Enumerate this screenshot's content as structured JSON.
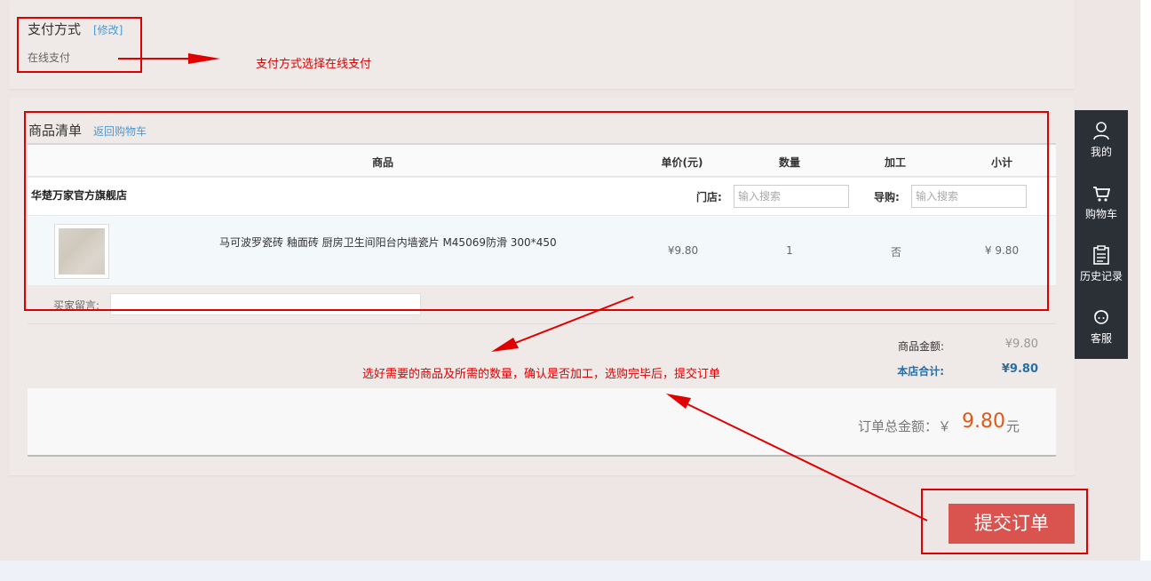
{
  "payment": {
    "title": "支付方式",
    "edit_label": "[修改]",
    "method": "在线支付"
  },
  "product_list": {
    "title": "商品清单",
    "back_to_cart": "返回购物车",
    "columns": [
      "商品",
      "单价(元)",
      "数量",
      "加工",
      "小计"
    ],
    "shop": {
      "name": "华楚万家官方旗舰店",
      "store_label": "门店:",
      "store_placeholder": "输入搜索",
      "guide_label": "导购:",
      "guide_placeholder": "输入搜索"
    },
    "items": [
      {
        "name": "马可波罗瓷砖 釉面砖 厨房卫生间阳台内墙瓷片 M45069防滑 300*450",
        "price": "¥9.80",
        "quantity": "1",
        "processing": "否",
        "subtotal": "¥ 9.80"
      }
    ],
    "memo_label": "买家留言:"
  },
  "summary": {
    "goods_amount_label": "商品金额:",
    "goods_amount": "¥9.80",
    "store_total_label": "本店合计:",
    "store_total": "¥9.80",
    "order_total_label": "订单总金额：￥",
    "order_total": "9.80",
    "order_total_unit": "元"
  },
  "submit": {
    "label": "提交订单"
  },
  "sidebar": {
    "items": [
      {
        "label": "我的",
        "icon": "user-icon"
      },
      {
        "label": "购物车",
        "icon": "cart-icon"
      },
      {
        "label": "历史记录",
        "icon": "clipboard-icon"
      },
      {
        "label": "客服",
        "icon": "headset-icon"
      }
    ]
  },
  "annotations": {
    "payment_note": "支付方式选择在线支付",
    "products_note": "选好需要的商品及所需的数量，确认是否加工，选购完毕后，提交订单",
    "color": "#e00000"
  }
}
